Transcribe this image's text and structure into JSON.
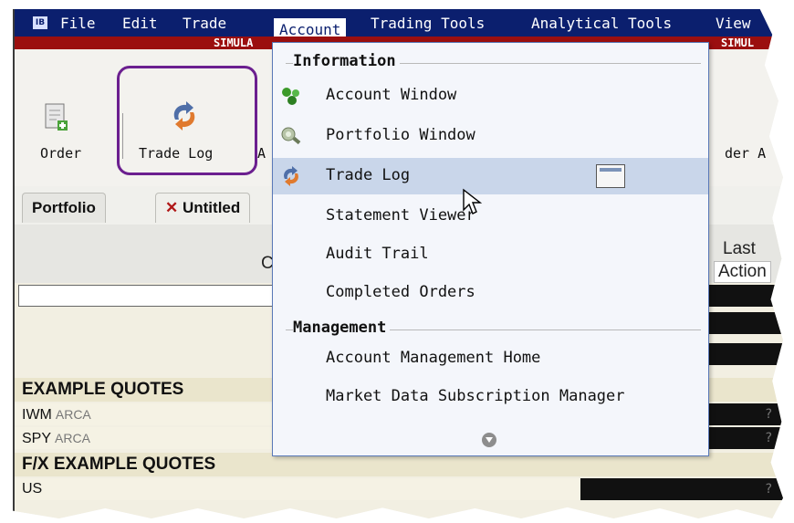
{
  "menubar": {
    "logo": "IB",
    "items": [
      "File",
      "Edit",
      "Trade",
      "Account",
      "Trading Tools",
      "Analytical Tools",
      "View"
    ],
    "active": "Account"
  },
  "sim_banner": {
    "left": "SIMULA",
    "right": "SIMUL"
  },
  "toolbar": {
    "order_label": "Order",
    "trade_log_label": "Trade Log",
    "partial_label": "A",
    "right_label": "der  A"
  },
  "tabs": {
    "portfolio": "Portfolio",
    "untitled": "Untitled",
    "close_glyph": "✕"
  },
  "grid": {
    "col_c": "C",
    "col_last": "Last",
    "col_action": "Action",
    "sections": [
      "EXAMPLE QUOTES",
      "F/X EXAMPLE QUOTES"
    ],
    "rows": [
      {
        "symbol": "IWM",
        "exchange": "ARCA",
        "value": "?"
      },
      {
        "symbol": "SPY",
        "exchange": "ARCA",
        "value": "?"
      },
      {
        "symbol": "US",
        "exchange": "",
        "value": "?"
      }
    ]
  },
  "dropdown": {
    "group_information": "Information",
    "group_management": "Management",
    "items": {
      "account_window": "Account Window",
      "portfolio_window": "Portfolio Window",
      "trade_log": "Trade Log",
      "statement_viewer": "Statement Viewer",
      "audit_trail": "Audit Trail",
      "completed_orders": "Completed Orders",
      "account_management_home": "Account Management Home",
      "market_data_subscription_manager": "Market Data Subscription Manager"
    },
    "selected": "Trade Log"
  },
  "colors": {
    "menubar": "#0b1f6e",
    "sim": "#9b0f0f",
    "highlight": "#6b1f8f",
    "selected": "#c9d6ea"
  }
}
